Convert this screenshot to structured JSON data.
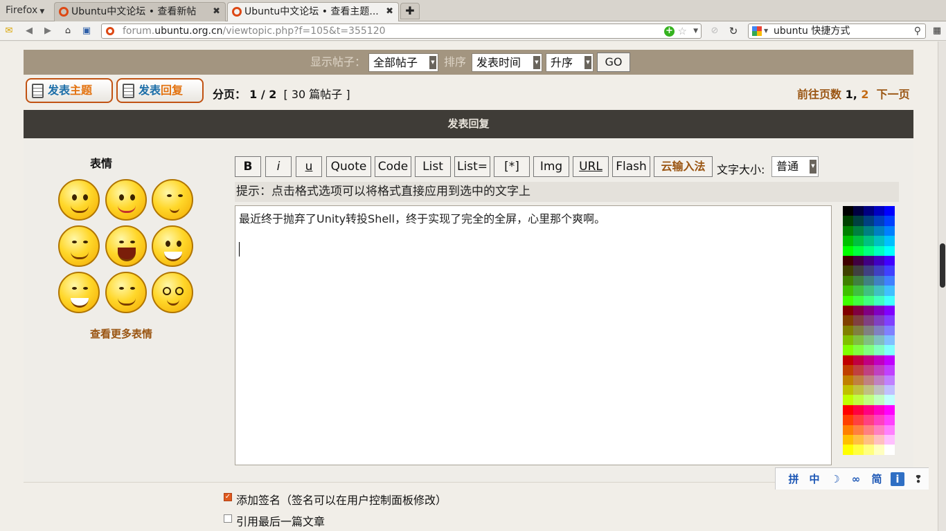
{
  "browser": {
    "menu_label": "Firefox",
    "tabs": [
      {
        "title": "Ubuntu中文论坛 • 查看新帖"
      },
      {
        "title": "Ubuntu中文论坛 • 查看主题..."
      }
    ],
    "url_prefix": "forum.",
    "url_domain": "ubuntu.org.cn",
    "url_path": "/viewtopic.php?f=105&t=355120",
    "search_text": "ubuntu 快捷方式"
  },
  "sort_bar": {
    "show_label": "显示帖子：",
    "show_value": "全部帖子",
    "sort_label": "排序",
    "sort_by_value": "发表时间",
    "order_value": "升序",
    "go_label": "GO"
  },
  "actions": {
    "new_topic_main": "发表",
    "new_topic_hl": "主题",
    "reply_main": "发表",
    "reply_hl": "回复"
  },
  "pagination": {
    "label": "分页：",
    "current": "1 / 2",
    "count": "[ 30 篇帖子 ]",
    "goto_label": "前往页数",
    "page_1": "1",
    "page_2": "2",
    "next": "下一页"
  },
  "reply_form": {
    "header": "发表回复",
    "smilies_title": "表情",
    "more_smilies": "查看更多表情",
    "format_buttons": [
      "B",
      "i",
      "u",
      "Quote",
      "Code",
      "List",
      "List=",
      "[*]",
      "Img",
      "URL",
      "Flash"
    ],
    "ime_button": "云输入法",
    "font_size_label": "文字大小:",
    "font_size_value": "普通",
    "hint": "提示：点击格式选项可以将格式直接应用到选中的文字上",
    "message": "最近终于抛弃了Unity转投Shell，终于实现了完全的全屏，心里那个爽啊。",
    "attach_sig_label": "添加签名（签名可以在用户控制面板修改）",
    "quote_last_label": "引用最后一篇文章"
  },
  "ime_toolbar": {
    "items": [
      "拼",
      "中",
      "☽",
      "∞",
      "简",
      "i",
      "❢"
    ]
  },
  "colors": {
    "accent_orange": "#dd4814",
    "sortbar_bg": "#a39580",
    "header_bg": "#3f3c37",
    "link_brown": "#9a5512"
  }
}
